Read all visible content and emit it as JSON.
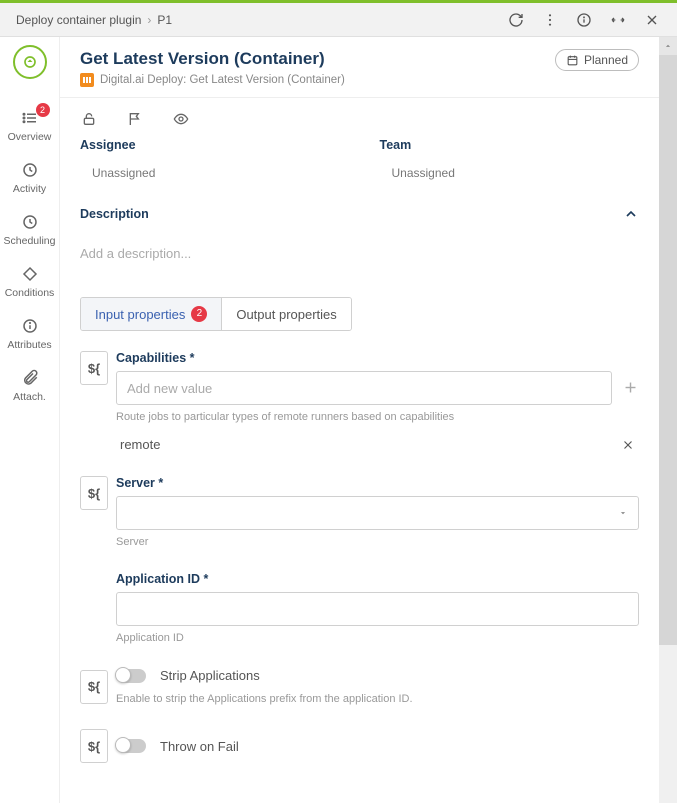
{
  "breadcrumb": {
    "parent": "Deploy container plugin",
    "current": "P1"
  },
  "status": {
    "label": "Planned"
  },
  "rail": {
    "overview": {
      "label": "Overview",
      "badge": "2"
    },
    "activity": {
      "label": "Activity"
    },
    "scheduling": {
      "label": "Scheduling"
    },
    "conditions": {
      "label": "Conditions"
    },
    "attributes": {
      "label": "Attributes"
    },
    "attach": {
      "label": "Attach."
    }
  },
  "page": {
    "title": "Get Latest Version (Container)",
    "subtitle": "Digital.ai Deploy: Get Latest Version (Container)"
  },
  "sections": {
    "assignee": {
      "label": "Assignee",
      "value": "Unassigned"
    },
    "team": {
      "label": "Team",
      "value": "Unassigned"
    },
    "description": {
      "label": "Description",
      "placeholder": "Add a description..."
    }
  },
  "tabs": {
    "input": {
      "label": "Input properties",
      "badge": "2"
    },
    "output": {
      "label": "Output properties"
    }
  },
  "form": {
    "capabilities": {
      "label": "Capabilities *",
      "placeholder": "Add new value",
      "help": "Route jobs to particular types of remote runners based on capabilities",
      "chips": [
        "remote"
      ]
    },
    "server": {
      "label": "Server *",
      "help": "Server"
    },
    "application_id": {
      "label": "Application ID *",
      "help": "Application ID"
    },
    "strip": {
      "label": "Strip Applications",
      "help": "Enable to strip the Applications prefix from the application ID."
    },
    "throw": {
      "label": "Throw on Fail"
    }
  }
}
